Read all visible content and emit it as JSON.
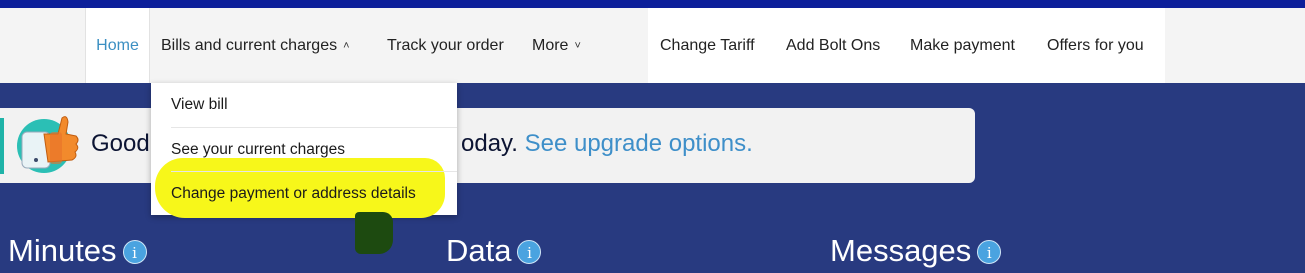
{
  "nav": {
    "home": "Home",
    "bills": "Bills and current charges",
    "track": "Track your order",
    "more": "More",
    "change_tariff": "Change Tariff",
    "add_bolt_ons": "Add Bolt Ons",
    "make_payment": "Make payment",
    "offers": "Offers for you"
  },
  "dropdown": {
    "items": [
      "View bill",
      "See your current charges",
      "Change payment or address details"
    ]
  },
  "banner": {
    "text_lead": "Good",
    "text_mid": "oday.",
    "link": "See upgrade options."
  },
  "stats": {
    "minutes": "Minutes",
    "data": "Data",
    "messages": "Messages",
    "info_glyph": "i"
  },
  "colors": {
    "accent_link": "#3b8fc2",
    "page_bg": "#283a80",
    "top_strip": "#0c1f9a",
    "highlight": "#f7f71a"
  }
}
